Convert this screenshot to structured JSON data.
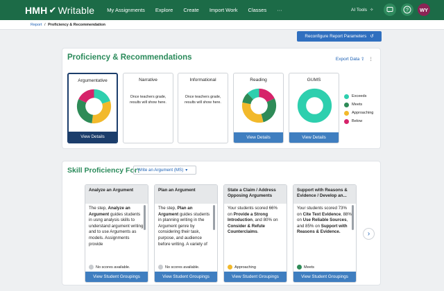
{
  "header": {
    "brand": "HMH",
    "product": "Writable",
    "nav": [
      "My Assignments",
      "Explore",
      "Create",
      "Import Work",
      "Classes",
      "···"
    ],
    "ai_tools": "AI Tools",
    "avatar_initials": "WY"
  },
  "breadcrumb": {
    "link": "Report",
    "separator": "/",
    "current": "Proficiency & Recommendation"
  },
  "reconfigure_label": "Reconfigure Report Parameters",
  "proficiency": {
    "title": "Proficiency & Recommendations",
    "export_label": "Export Data",
    "cards": [
      {
        "title": "Argumentative",
        "selected": true,
        "graded": true,
        "button": "View Details",
        "segments": [
          {
            "status": "Exceeds",
            "value": 0.2
          },
          {
            "status": "Approaching",
            "value": 0.32
          },
          {
            "status": "Meets",
            "value": 0.3
          },
          {
            "status": "Below",
            "value": 0.18
          }
        ]
      },
      {
        "title": "Narrative",
        "graded": false,
        "message": "Once teachers grade, results will show here."
      },
      {
        "title": "Informational",
        "graded": false,
        "message": "Once teachers grade, results will show here."
      },
      {
        "title": "Reading",
        "graded": true,
        "button": "View Details",
        "segments": [
          {
            "status": "Below",
            "value": 0.18
          },
          {
            "status": "Meets",
            "value": 0.28
          },
          {
            "status": "Approaching",
            "value": 0.32
          },
          {
            "status": "Meets",
            "value": 0.1
          },
          {
            "status": "Exceeds",
            "value": 0.12
          }
        ]
      },
      {
        "title": "GUMS",
        "graded": true,
        "button": "View Details",
        "segments": [
          {
            "status": "Exceeds",
            "value": 1.0
          }
        ]
      }
    ],
    "legend": [
      {
        "label": "Exceeds",
        "color": "#2ecfae"
      },
      {
        "label": "Meets",
        "color": "#2e8b57"
      },
      {
        "label": "Approaching",
        "color": "#f2b92b"
      },
      {
        "label": "Below",
        "color": "#d6236a"
      }
    ]
  },
  "skills": {
    "title": "Skill Proficiency For:",
    "dropdown": "Write an Argument (MS)",
    "cards": [
      {
        "title": "Analyze an Argument",
        "body": "The step, Analyze an Argument guides students in usng analysis skills to understand argument writing and to use Arguments as models. Assignments provide",
        "status": "No scores available.",
        "status_color": "#c8cbcf",
        "button": "View Student Groupings"
      },
      {
        "title": "Plan an Argument",
        "body": "The step, Plan an Argument guides students in planning writing in the Argument genre by considering their task, purpose, and audience before writing. A variety of",
        "status": "No scores available.",
        "status_color": "#c8cbcf",
        "button": "View Student Groupings"
      },
      {
        "title": "State a Claim / Address Opposing Arguments",
        "body": "Your students scored 66% on Provide a Strong Introduction, and 80% on Consider & Refute Counterclaims.",
        "status": "Approaching",
        "status_color": "#f2b92b",
        "button": "View Student Groupings"
      },
      {
        "title": "Support with Reasons & Evidence / Develop an...",
        "body": "Your students scored 73% on Cite Text Evidence, 88% on Use Reliable Sources, and 85% on Support with Reasons & Evidence.",
        "status": "Meets",
        "status_color": "#2e8b57",
        "button": "View Student Groupings"
      }
    ]
  }
}
